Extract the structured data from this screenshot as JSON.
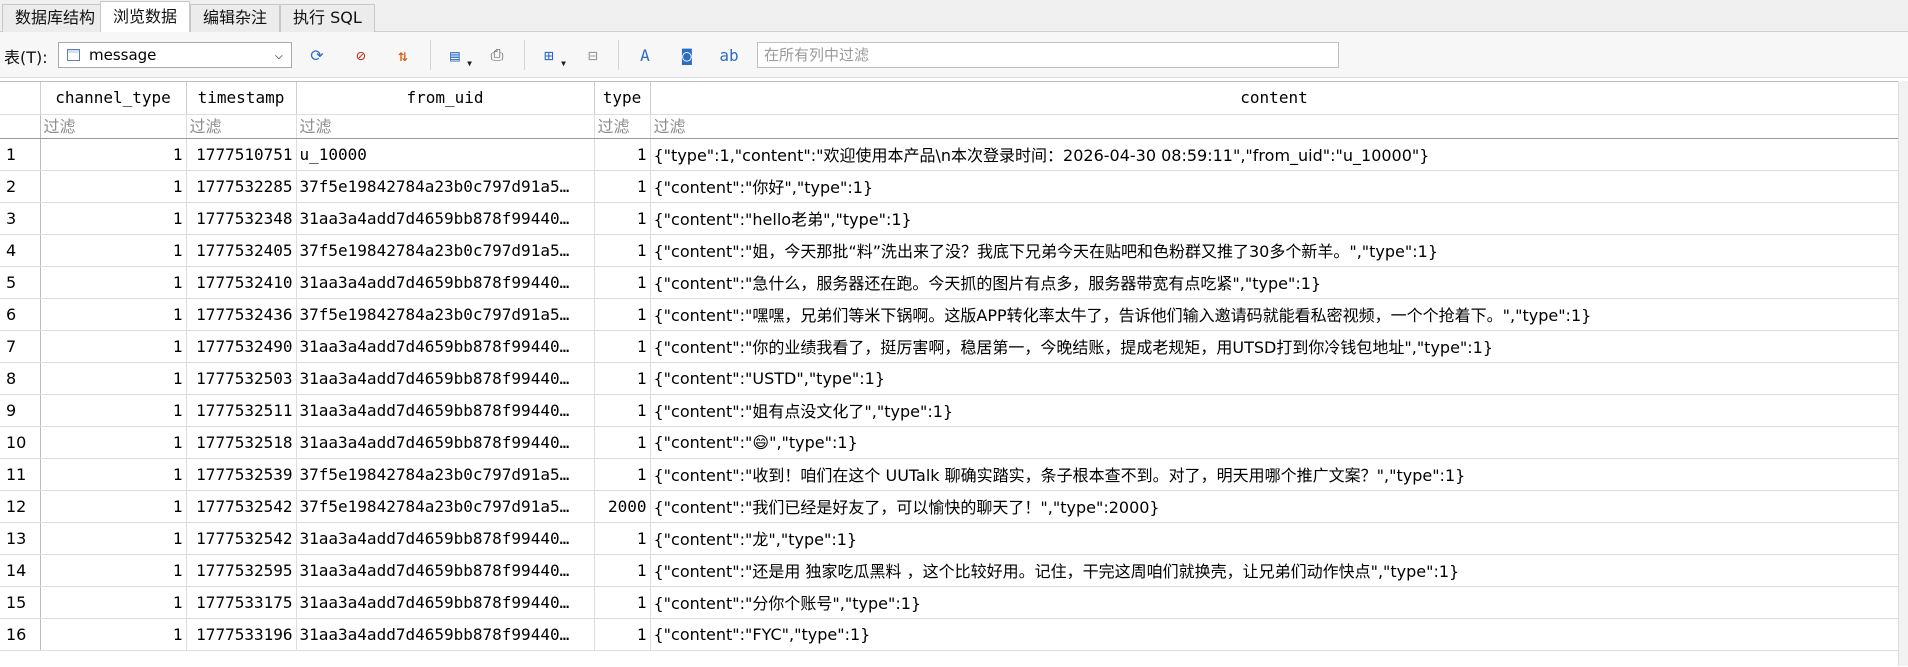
{
  "tabs": [
    {
      "label": "数据库结构",
      "active": false
    },
    {
      "label": "浏览数据",
      "active": true
    },
    {
      "label": "编辑杂注",
      "active": false
    },
    {
      "label": "执行 SQL",
      "active": false
    }
  ],
  "toolbar": {
    "table_label": "表(T):",
    "table_value": "message",
    "filter_all_placeholder": "在所有列中过滤"
  },
  "grid": {
    "columns": [
      "channel_type",
      "timestamp",
      "from_uid",
      "type",
      "content"
    ],
    "filter_placeholder": "过滤",
    "rows": [
      [
        "1",
        "1",
        "1777510751",
        "u_10000",
        "1",
        "{\"type\":1,\"content\":\"欢迎使用本产品\\n本次登录时间：2026-04-30 08:59:11\",\"from_uid\":\"u_10000\"}"
      ],
      [
        "2",
        "1",
        "1777532285",
        "37f5e19842784a23b0c797d91a5…",
        "1",
        "{\"content\":\"你好\",\"type\":1}"
      ],
      [
        "3",
        "1",
        "1777532348",
        "31aa3a4add7d4659bb878f99440…",
        "1",
        "{\"content\":\"hello老弟\",\"type\":1}"
      ],
      [
        "4",
        "1",
        "1777532405",
        "37f5e19842784a23b0c797d91a5…",
        "1",
        "{\"content\":\"姐，今天那批“料”洗出来了没？我底下兄弟今天在贴吧和色粉群又推了30多个新羊。\",\"type\":1}"
      ],
      [
        "5",
        "1",
        "1777532410",
        "31aa3a4add7d4659bb878f99440…",
        "1",
        "{\"content\":\"急什么，服务器还在跑。今天抓的图片有点多，服务器带宽有点吃紧\",\"type\":1}"
      ],
      [
        "6",
        "1",
        "1777532436",
        "37f5e19842784a23b0c797d91a5…",
        "1",
        "{\"content\":\"嘿嘿，兄弟们等米下锅啊。这版APP转化率太牛了，告诉他们输入邀请码就能看私密视频，一个个抢着下。\",\"type\":1}"
      ],
      [
        "7",
        "1",
        "1777532490",
        "31aa3a4add7d4659bb878f99440…",
        "1",
        "{\"content\":\"你的业绩我看了，挺厉害啊，稳居第一，今晚结账，提成老规矩，用UTSD打到你冷钱包地址\",\"type\":1}"
      ],
      [
        "8",
        "1",
        "1777532503",
        "31aa3a4add7d4659bb878f99440…",
        "1",
        "{\"content\":\"USTD\",\"type\":1}"
      ],
      [
        "9",
        "1",
        "1777532511",
        "31aa3a4add7d4659bb878f99440…",
        "1",
        "{\"content\":\"姐有点没文化了\",\"type\":1}"
      ],
      [
        "10",
        "1",
        "1777532518",
        "31aa3a4add7d4659bb878f99440…",
        "1",
        "{\"content\":\"😄\",\"type\":1}"
      ],
      [
        "11",
        "1",
        "1777532539",
        "37f5e19842784a23b0c797d91a5…",
        "1",
        "{\"content\":\"收到！咱们在这个 UUTalk 聊确实踏实，条子根本查不到。对了，明天用哪个推广文案？\",\"type\":1}"
      ],
      [
        "12",
        "1",
        "1777532542",
        "37f5e19842784a23b0c797d91a5…",
        "2000",
        "{\"content\":\"我们已经是好友了，可以愉快的聊天了！\",\"type\":2000}"
      ],
      [
        "13",
        "1",
        "1777532542",
        "31aa3a4add7d4659bb878f99440…",
        "1",
        "{\"content\":\"龙\",\"type\":1}"
      ],
      [
        "14",
        "1",
        "1777532595",
        "31aa3a4add7d4659bb878f99440…",
        "1",
        "{\"content\":\"还是用 独家吃瓜黑料 ，这个比较好用。记住，干完这周咱们就换壳，让兄弟们动作快点\",\"type\":1}"
      ],
      [
        "15",
        "1",
        "1777533175",
        "31aa3a4add7d4659bb878f99440…",
        "1",
        "{\"content\":\"分你个账号\",\"type\":1}"
      ],
      [
        "16",
        "1",
        "1777533196",
        "31aa3a4add7d4659bb878f99440…",
        "1",
        "{\"content\":\"FYC\",\"type\":1}"
      ]
    ]
  }
}
